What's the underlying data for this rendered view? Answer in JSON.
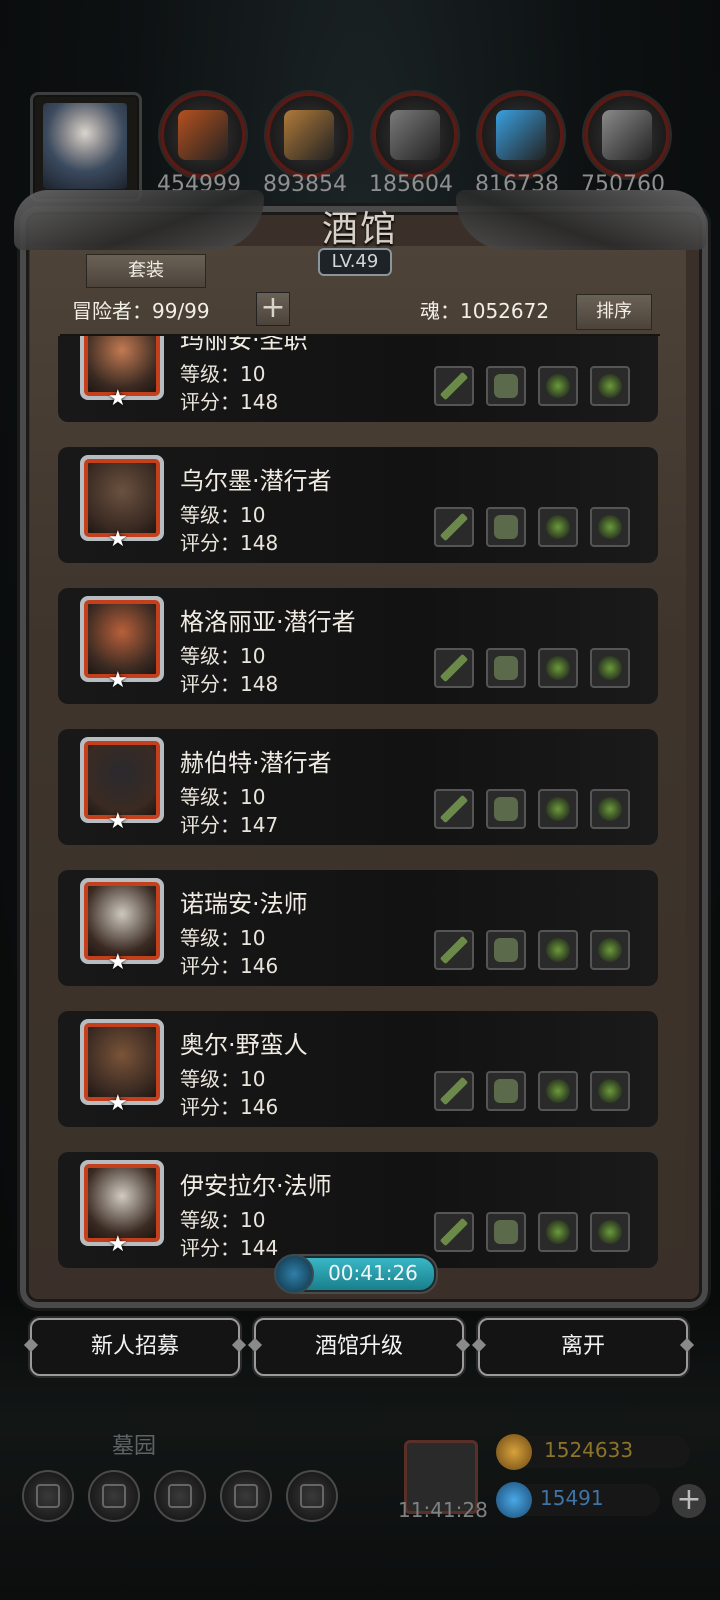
{
  "top_bar": {
    "resources": [
      {
        "value": "454999",
        "icon": "meat-icon",
        "color": "#b5511f"
      },
      {
        "value": "893854",
        "icon": "wood-icon",
        "color": "#b07a3a"
      },
      {
        "value": "185604",
        "icon": "stone-icon",
        "color": "#7a7a7a"
      },
      {
        "value": "816738",
        "icon": "crystal-icon",
        "color": "#3aa0e0"
      },
      {
        "value": "750760",
        "icon": "iron-icon",
        "color": "#8a8a8a"
      }
    ]
  },
  "tavern": {
    "title": "酒馆",
    "level": "LV.49",
    "set_button": "套装",
    "adventurers_label": "冒险者：99/99",
    "add_symbol": "+",
    "soul_label": "魂：1052672",
    "sort_button": "排序"
  },
  "heroes": [
    {
      "name": "玛丽安·圣职",
      "level": "等级：10",
      "score": "评分：148",
      "star": "★",
      "face": "#c27a52",
      "weapon": "axe-icon"
    },
    {
      "name": "乌尔墨·潜行者",
      "level": "等级：10",
      "score": "评分：148",
      "star": "★",
      "face": "#6a5240",
      "weapon": "dagger-icon"
    },
    {
      "name": "格洛丽亚·潜行者",
      "level": "等级：10",
      "score": "评分：148",
      "star": "★",
      "face": "#b8603a",
      "weapon": "dagger-icon"
    },
    {
      "name": "赫伯特·潜行者",
      "level": "等级：10",
      "score": "评分：147",
      "star": "★",
      "face": "#2a2a2e",
      "weapon": "dagger-icon"
    },
    {
      "name": "诺瑞安·法师",
      "level": "等级：10",
      "score": "评分：146",
      "star": "★",
      "face": "#cdc8bf",
      "weapon": "staff-icon"
    },
    {
      "name": "奥尔·野蛮人",
      "level": "等级：10",
      "score": "评分：146",
      "star": "★",
      "face": "#7a5438",
      "weapon": "axe-icon"
    },
    {
      "name": "伊安拉尔·法师",
      "level": "等级：10",
      "score": "评分：144",
      "star": "★",
      "face": "#d0cbc2",
      "weapon": "staff-icon"
    }
  ],
  "timer": "00:41:26",
  "actions": {
    "recruit": "新人招募",
    "upgrade": "酒馆升级",
    "leave": "离开"
  },
  "background": {
    "grave_label": "墓园",
    "gift_timer": "11:41:28",
    "gold": "1524633",
    "gems": "15491",
    "add_symbol": "+"
  }
}
